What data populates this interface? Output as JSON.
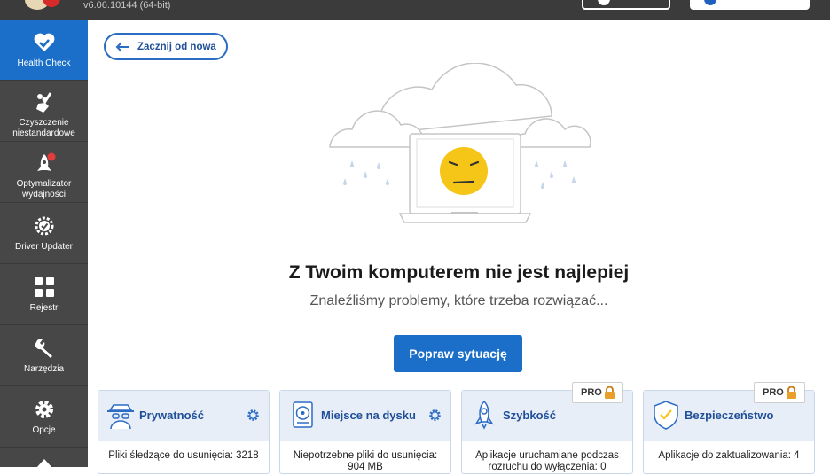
{
  "app": {
    "version": "v6.06.10144 (64-bit)",
    "colors": {
      "accent": "#1c6fc8",
      "sidebar": "#474747",
      "topbar": "#3b3b3b",
      "card_head": "#e8eef8",
      "title_blue": "#1f4f97"
    }
  },
  "sidebar": {
    "items": [
      {
        "label": "Health Check",
        "icon": "heart-check-icon",
        "active": true
      },
      {
        "label": "Czyszczenie niestandardowe",
        "icon": "broom-icon",
        "active": false
      },
      {
        "label": "Optymalizator wydajności",
        "icon": "rocket-icon",
        "active": false,
        "badge": "red-dot"
      },
      {
        "label": "Driver Updater",
        "icon": "gear-chip-icon",
        "active": false
      },
      {
        "label": "Rejestr",
        "icon": "grid-icon",
        "active": false
      },
      {
        "label": "Narzędzia",
        "icon": "wrench-icon",
        "active": false
      },
      {
        "label": "Opcje",
        "icon": "settings-gear-icon",
        "active": false
      }
    ]
  },
  "main": {
    "back_label": "Zacznij od nowa",
    "headline": "Z Twoim komputerem nie jest najlepiej",
    "subline": "Znaleźliśmy problemy, które trzeba rozwiązać...",
    "fix_label": "Popraw sytuację"
  },
  "cards": [
    {
      "title": "Prywatność",
      "icon": "spy-icon",
      "settings": true,
      "pro": false,
      "line1": "Pliki śledzące do usunięcia: 3218",
      "line2": ""
    },
    {
      "title": "Miejsce na dysku",
      "icon": "disk-icon",
      "settings": true,
      "pro": false,
      "line1": "Niepotrzebne pliki do usunięcia:",
      "line2": "904 MB"
    },
    {
      "title": "Szybkość",
      "icon": "rocket-icon",
      "settings": false,
      "pro": true,
      "line1": "Aplikacje uruchamiane podczas",
      "line2": "rozruchu do wyłączenia: 0"
    },
    {
      "title": "Bezpieczeństwo",
      "icon": "shield-check-icon",
      "settings": false,
      "pro": true,
      "line1": "Aplikacje do zaktualizowania: 4",
      "line2": ""
    }
  ],
  "pro_label": "PRO"
}
